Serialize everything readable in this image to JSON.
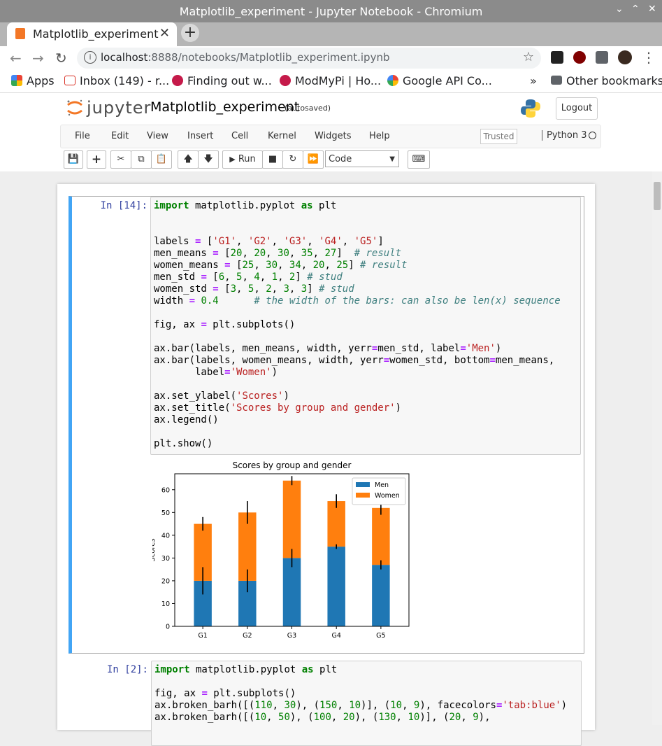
{
  "window": {
    "title": "Matplotlib_experiment - Jupyter Notebook - Chromium"
  },
  "tab": {
    "title": "Matplotlib_experiment - Jupyter"
  },
  "address": {
    "host": "localhost",
    "path": ":8888/notebooks/Matplotlib_experiment.ipynb"
  },
  "bookmarks": [
    {
      "label": "Apps",
      "icon": "apps-grid-icon",
      "color": "#4285f4"
    },
    {
      "label": "Inbox (149) - r...",
      "icon": "gmail-icon",
      "color": "#d93025"
    },
    {
      "label": "Finding out w...",
      "icon": "raspberry-icon",
      "color": "#c51a4a"
    },
    {
      "label": "ModMyPi | Ho...",
      "icon": "raspberry-icon",
      "color": "#c51a4a"
    },
    {
      "label": "Google API Co...",
      "icon": "google-icon",
      "color": "#4285f4"
    }
  ],
  "bookmarks_more": "»",
  "other_bookmarks": "Other bookmarks",
  "jupyter": {
    "logo_text": "jupyter",
    "notebook_name": "Matplotlib_experiment",
    "autosave": "(autosaved)",
    "logout": "Logout",
    "menus": [
      "File",
      "Edit",
      "View",
      "Insert",
      "Cell",
      "Kernel",
      "Widgets",
      "Help"
    ],
    "trusted": "Trusted",
    "kernel": "Python 3",
    "run_label": "Run",
    "cell_type": "Code"
  },
  "cells": [
    {
      "prompt": "In [14]:",
      "code_lines": [
        "import matplotlib.pyplot as plt",
        "",
        "",
        "labels = ['G1', 'G2', 'G3', 'G4', 'G5']",
        "men_means = [20, 20, 30, 35, 27]  # result",
        "women_means = [25, 30, 34, 20, 25] # result",
        "men_std = [6, 5, 4, 1, 2] # stud",
        "women_std = [3, 5, 2, 3, 3] # stud",
        "width = 0.4      # the width of the bars: can also be len(x) sequence",
        "",
        "fig, ax = plt.subplots()",
        "",
        "ax.bar(labels, men_means, width, yerr=men_std, label='Men')",
        "ax.bar(labels, women_means, width, yerr=women_std, bottom=men_means,",
        "       label='Women')",
        "",
        "ax.set_ylabel('Scores')",
        "ax.set_title('Scores by group and gender')",
        "ax.legend()",
        "",
        "plt.show()"
      ]
    },
    {
      "prompt": "In [2]:",
      "code_lines": [
        "import matplotlib.pyplot as plt",
        "",
        "fig, ax = plt.subplots()",
        "ax.broken_barh([(110, 30), (150, 10)], (10, 9), facecolors='tab:blue')",
        "ax.broken_barh([(10, 50), (100, 20), (130, 10)], (20, 9),"
      ]
    }
  ],
  "chart_data": {
    "type": "bar",
    "title": "Scores by group and gender",
    "ylabel": "Scores",
    "xlabel": "",
    "categories": [
      "G1",
      "G2",
      "G3",
      "G4",
      "G5"
    ],
    "stacked": true,
    "ylim": [
      0,
      67
    ],
    "yticks": [
      0,
      10,
      20,
      30,
      40,
      50,
      60
    ],
    "legend_position": "top-right",
    "series": [
      {
        "name": "Men",
        "values": [
          20,
          20,
          30,
          35,
          27
        ],
        "errors": [
          6,
          5,
          4,
          1,
          2
        ],
        "color": "#1f77b4"
      },
      {
        "name": "Women",
        "values": [
          25,
          30,
          34,
          20,
          25
        ],
        "errors": [
          3,
          5,
          2,
          3,
          3
        ],
        "color": "#ff7f0e"
      }
    ]
  }
}
